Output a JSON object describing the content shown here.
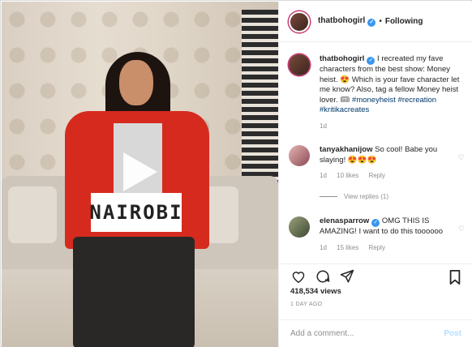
{
  "header": {
    "username": "thatbohogirl",
    "separator": "•",
    "follow_status": "Following"
  },
  "media": {
    "overlay_text": "NAIROBI"
  },
  "comments": [
    {
      "username": "thatbohogirl",
      "text": "I recreated my fave characters from the best show: Money heist. 😍 Which is your fave character let me know? Also, tag a fellow Money heist lover. 🎟",
      "tags": "#moneyheist #recreation #kritikacreates",
      "time": "1d"
    },
    {
      "username": "tanyakhanijow",
      "text": "So cool! Babe you slaying! 😍😍😍",
      "time": "1d",
      "likes": "10 likes",
      "reply": "Reply",
      "view_replies": "View replies (1)"
    },
    {
      "username": "elenasparrow",
      "text": "OMG THIS IS AMAZING! I want to do this toooooo",
      "time": "1d",
      "likes": "15 likes",
      "reply": "Reply"
    }
  ],
  "stats": {
    "views": "418,534 views",
    "posted": "1 DAY AGO"
  },
  "composer": {
    "placeholder": "Add a comment...",
    "post_label": "Post"
  },
  "colors": {
    "verified": "#3897f0",
    "tag_link": "#00376b",
    "story_ring": "#c7356f",
    "post_button_disabled": "#b2dffc"
  },
  "icons": [
    "verified-badge-icon",
    "play-icon",
    "heart-icon",
    "comment-icon",
    "share-icon",
    "save-icon"
  ]
}
